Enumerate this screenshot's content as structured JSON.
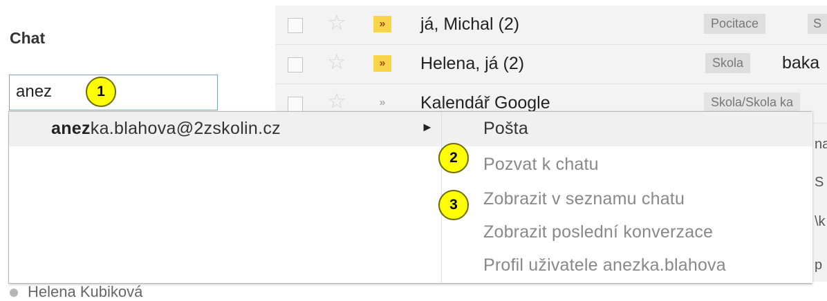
{
  "chat": {
    "title": "Chat",
    "search_value": "anez"
  },
  "badges": [
    "1",
    "2",
    "3"
  ],
  "mail_rows": [
    {
      "sender": "já, Michal (2)",
      "label": "Pocitace",
      "label2": "S",
      "subject": "",
      "important": true
    },
    {
      "sender": "Helena, já (2)",
      "label": "Skola",
      "label2": "",
      "subject": "baka",
      "important": true
    },
    {
      "sender": "Kalendář Google",
      "label": "Skola/Skola ka",
      "label2": "",
      "subject": "",
      "important": false
    }
  ],
  "suggestion": {
    "email_match": "anez",
    "email_rest": "ka.blahova@2zskolin.cz"
  },
  "menu": {
    "items": [
      "Pošta",
      "Pozvat k chatu",
      "Zobrazit v seznamu chatu",
      "Zobrazit poslední konverzace",
      "Profil uživatele anezka.blahova"
    ]
  },
  "contact_peek": "Helena Kubiková",
  "peek_fragments": [
    "na",
    "S",
    "\\k",
    "p"
  ]
}
